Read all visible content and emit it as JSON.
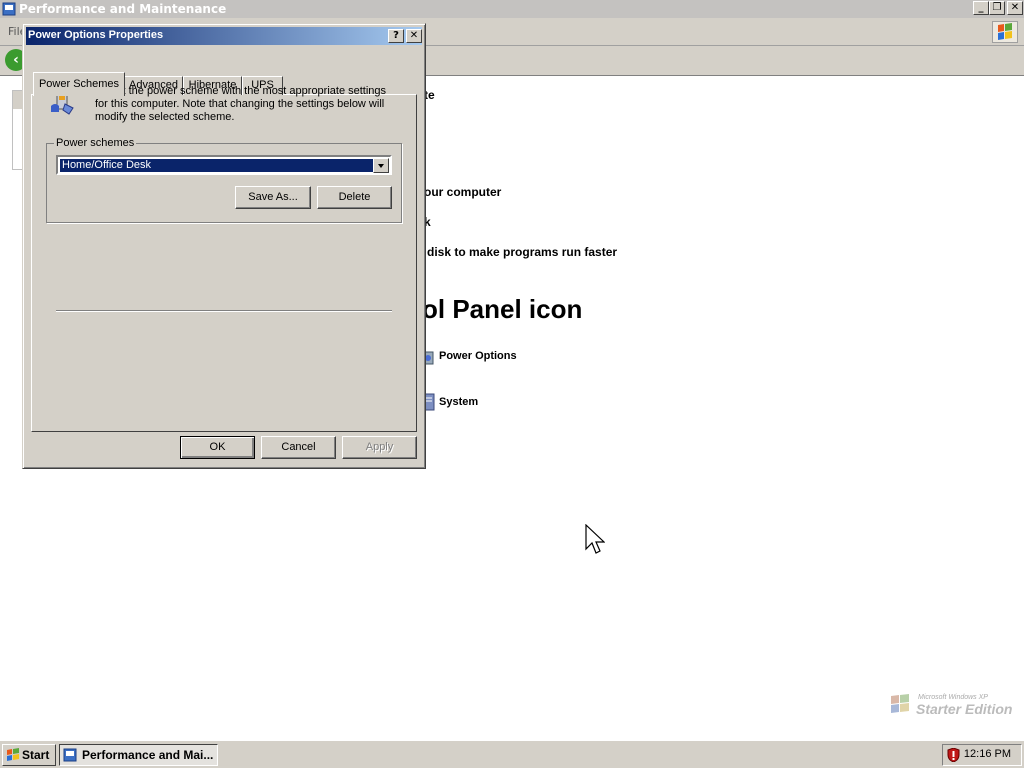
{
  "background_window": {
    "title": "Performance and Maintenance",
    "menu_file": "File",
    "lines": {
      "line1": "te",
      "line2": "our computer",
      "line3": "k",
      "line4": "disk to make programs run faster"
    },
    "heading": "ol Panel icon",
    "icon_items": [
      "Power Options",
      "System"
    ]
  },
  "dialog": {
    "title": "Power Options Properties",
    "help_button": "?",
    "close_button": "✕",
    "tabs": [
      "Power Schemes",
      "Advanced",
      "Hibernate",
      "UPS"
    ],
    "selected_tab": "Power Schemes",
    "description": "Select the power scheme with the most appropriate settings for this computer. Note that changing the settings below will modify the selected scheme.",
    "group_label": "Power schemes",
    "selected_scheme": "Home/Office Desk",
    "save_as_label": "Save As...",
    "delete_label": "Delete",
    "ok_label": "OK",
    "cancel_label": "Cancel",
    "apply_label": "Apply"
  },
  "taskbar": {
    "start_label": "Start",
    "task_label": "Performance and Mai...",
    "clock": "12:16 PM"
  },
  "watermark": {
    "small": "Microsoft Windows XP",
    "big": "Starter Edition"
  },
  "colors": {
    "dialog_face": "#d4d0c8",
    "title_active": "#0a246a",
    "selection": "#0a246a"
  }
}
